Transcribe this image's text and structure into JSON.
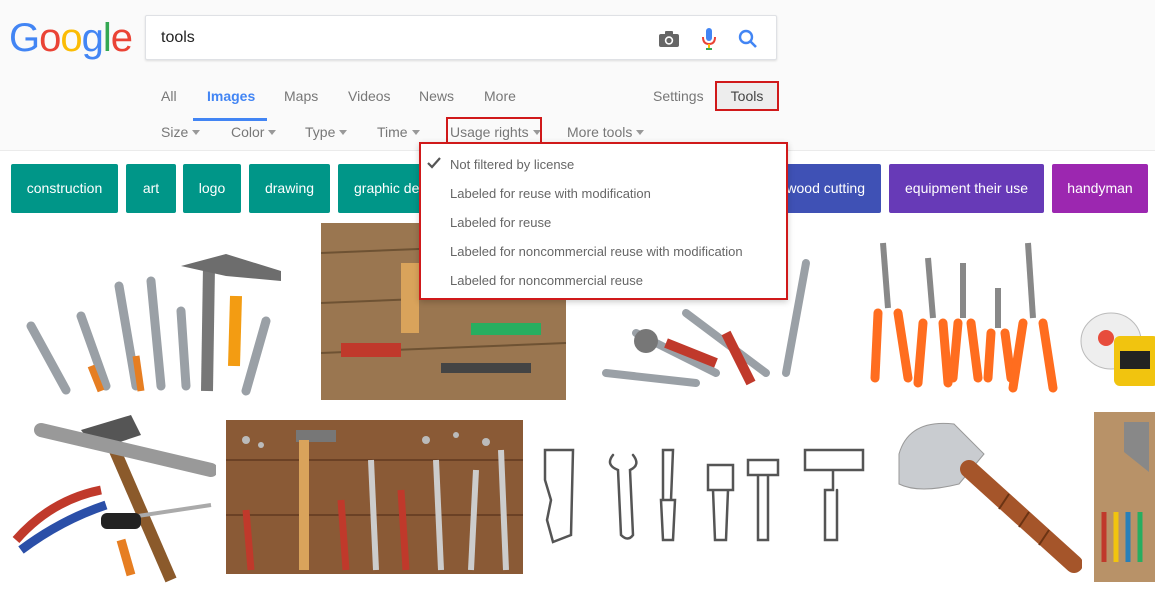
{
  "logo": {
    "letters": [
      "G",
      "o",
      "o",
      "g",
      "l",
      "e"
    ]
  },
  "search": {
    "value": "tools"
  },
  "tabs": [
    {
      "label": "All"
    },
    {
      "label": "Images"
    },
    {
      "label": "Maps"
    },
    {
      "label": "Videos"
    },
    {
      "label": "News"
    },
    {
      "label": "More"
    },
    {
      "label": "Settings"
    }
  ],
  "tools_label": "Tools",
  "filters": [
    {
      "label": "Size"
    },
    {
      "label": "Color"
    },
    {
      "label": "Type"
    },
    {
      "label": "Time"
    },
    {
      "label": "Usage rights"
    },
    {
      "label": "More tools"
    }
  ],
  "chips": [
    {
      "label": "construction",
      "color": "#009688"
    },
    {
      "label": "art",
      "color": "#009688"
    },
    {
      "label": "logo",
      "color": "#009688"
    },
    {
      "label": "drawing",
      "color": "#009688"
    },
    {
      "label": "graphic design",
      "color": "#009688"
    },
    {
      "label": "wood cutting",
      "color": "#3f51b5"
    },
    {
      "label": "equipment their use",
      "color": "#673ab7"
    },
    {
      "label": "handyman",
      "color": "#9c27b0"
    }
  ],
  "usage_menu": {
    "items": [
      {
        "label": "Not filtered by license",
        "checked": true
      },
      {
        "label": "Labeled for reuse with modification"
      },
      {
        "label": "Labeled for reuse"
      },
      {
        "label": "Labeled for noncommercial reuse with modification"
      },
      {
        "label": "Labeled for noncommercial reuse"
      }
    ]
  },
  "colors": {
    "accent": "#4285f4",
    "highlight": "#d0191a"
  }
}
